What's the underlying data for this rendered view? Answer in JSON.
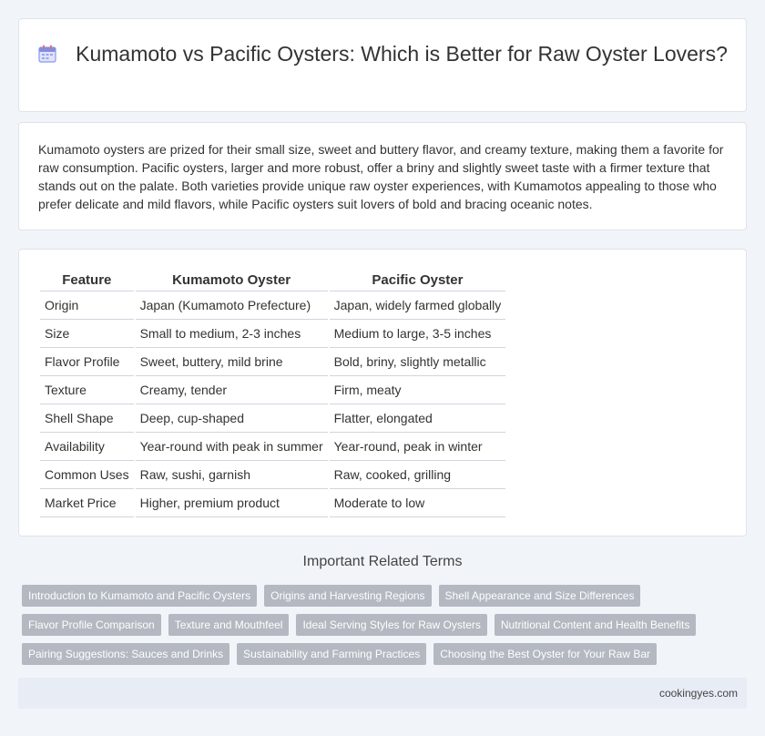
{
  "header": {
    "title": "Kumamoto vs Pacific Oysters: Which is Better for Raw Oyster Lovers?",
    "icon": "calendar-icon"
  },
  "intro": {
    "text": "Kumamoto oysters are prized for their small size, sweet and buttery flavor, and creamy texture, making them a favorite for raw consumption. Pacific oysters, larger and more robust, offer a briny and slightly sweet taste with a firmer texture that stands out on the palate. Both varieties provide unique raw oyster experiences, with Kumamotos appealing to those who prefer delicate and mild flavors, while Pacific oysters suit lovers of bold and bracing oceanic notes."
  },
  "table": {
    "headers": [
      "Feature",
      "Kumamoto Oyster",
      "Pacific Oyster"
    ],
    "rows": [
      [
        "Origin",
        "Japan (Kumamoto Prefecture)",
        "Japan, widely farmed globally"
      ],
      [
        "Size",
        "Small to medium, 2-3 inches",
        "Medium to large, 3-5 inches"
      ],
      [
        "Flavor Profile",
        "Sweet, buttery, mild brine",
        "Bold, briny, slightly metallic"
      ],
      [
        "Texture",
        "Creamy, tender",
        "Firm, meaty"
      ],
      [
        "Shell Shape",
        "Deep, cup-shaped",
        "Flatter, elongated"
      ],
      [
        "Availability",
        "Year-round with peak in summer",
        "Year-round, peak in winter"
      ],
      [
        "Common Uses",
        "Raw, sushi, garnish",
        "Raw, cooked, grilling"
      ],
      [
        "Market Price",
        "Higher, premium product",
        "Moderate to low"
      ]
    ]
  },
  "related": {
    "title": "Important Related Terms",
    "rows": [
      [
        "Introduction to Kumamoto and Pacific Oysters",
        "Origins and Harvesting Regions",
        "Shell Appearance and Size Differences"
      ],
      [
        "Flavor Profile Comparison",
        "Texture and Mouthfeel",
        "Ideal Serving Styles for Raw Oysters",
        "Nutritional Content and Health Benefits"
      ],
      [
        "Pairing Suggestions: Sauces and Drinks",
        "Sustainability and Farming Practices",
        "Choosing the Best Oyster for Your Raw Bar"
      ]
    ]
  },
  "footer": {
    "site": "cookingyes.com"
  }
}
